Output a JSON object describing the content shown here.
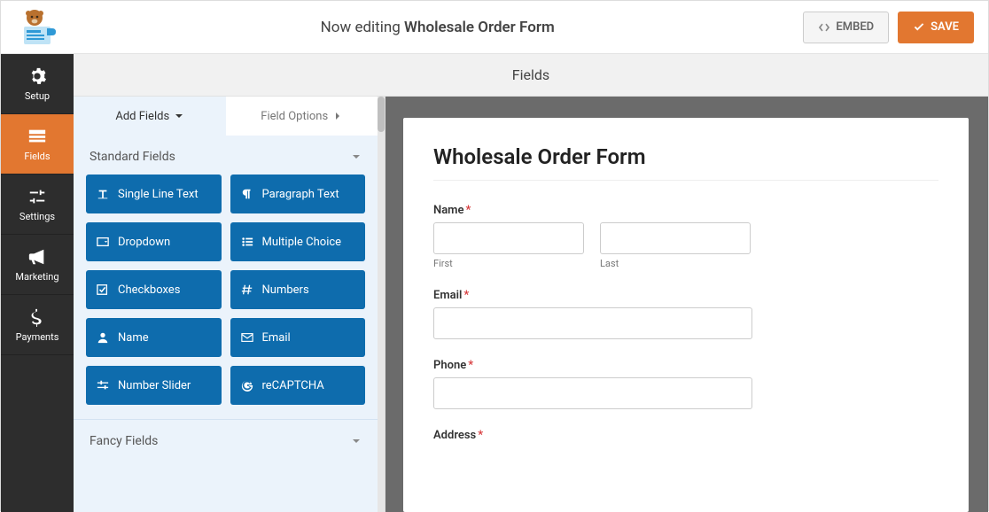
{
  "header": {
    "now_editing": "Now editing ",
    "form_name": "Wholesale Order Form",
    "embed_label": "EMBED",
    "save_label": "SAVE"
  },
  "nav": {
    "items": [
      {
        "label": "Setup"
      },
      {
        "label": "Fields"
      },
      {
        "label": "Settings"
      },
      {
        "label": "Marketing"
      },
      {
        "label": "Payments"
      }
    ]
  },
  "section_heading": "Fields",
  "panel_tabs": {
    "add_fields": "Add Fields",
    "field_options": "Field Options"
  },
  "groups": {
    "standard": "Standard Fields",
    "fancy": "Fancy Fields"
  },
  "field_buttons": [
    "Single Line Text",
    "Paragraph Text",
    "Dropdown",
    "Multiple Choice",
    "Checkboxes",
    "Numbers",
    "Name",
    "Email",
    "Number Slider",
    "reCAPTCHA"
  ],
  "preview": {
    "title": "Wholesale Order Form",
    "name_label": "Name",
    "first_sublabel": "First",
    "last_sublabel": "Last",
    "email_label": "Email",
    "phone_label": "Phone",
    "address_label": "Address"
  }
}
